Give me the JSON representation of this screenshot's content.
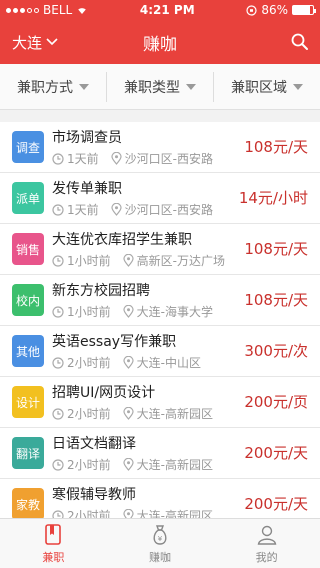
{
  "status": {
    "carrier": "BELL",
    "time": "4:21 PM",
    "battery": "86%",
    "battery_level": 0.86
  },
  "nav": {
    "city": "大连",
    "title": "赚咖"
  },
  "filters": [
    {
      "label": "兼职方式"
    },
    {
      "label": "兼职类型"
    },
    {
      "label": "兼职区域"
    }
  ],
  "jobs": [
    {
      "badge": "调查",
      "color": "#4a90e2",
      "title": "市场调查员",
      "time": "1天前",
      "location": "沙河口区-西安路",
      "price": "108元/天"
    },
    {
      "badge": "派单",
      "color": "#3cc6a0",
      "title": "发传单兼职",
      "time": "1天前",
      "location": "沙河口区-西安路",
      "price": "14元/小时"
    },
    {
      "badge": "销售",
      "color": "#e8558b",
      "title": "大连优衣库招学生兼职",
      "time": "1小时前",
      "location": "高新区-万达广场",
      "price": "108元/天"
    },
    {
      "badge": "校内",
      "color": "#3cbf6d",
      "title": "新东方校园招聘",
      "time": "1小时前",
      "location": "大连-海事大学",
      "price": "108元/天"
    },
    {
      "badge": "其他",
      "color": "#4a8fe2",
      "title": "英语essay写作兼职",
      "time": "2小时前",
      "location": "大连-中山区",
      "price": "300元/次"
    },
    {
      "badge": "设计",
      "color": "#f2c020",
      "title": "招聘UI/网页设计",
      "time": "2小时前",
      "location": "大连-高新园区",
      "price": "200元/页"
    },
    {
      "badge": "翻译",
      "color": "#3aaa9a",
      "title": "日语文档翻译",
      "time": "2小时前",
      "location": "大连-高新园区",
      "price": "200元/天"
    },
    {
      "badge": "家教",
      "color": "#f0a030",
      "title": "寒假辅导教师",
      "time": "2小时前",
      "location": "大连-高新园区",
      "price": "200元/天"
    }
  ],
  "tabs": [
    {
      "label": "兼职",
      "icon": "book-icon",
      "active": true
    },
    {
      "label": "赚咖",
      "icon": "money-bag-icon",
      "active": false
    },
    {
      "label": "我的",
      "icon": "user-icon",
      "active": false
    }
  ]
}
